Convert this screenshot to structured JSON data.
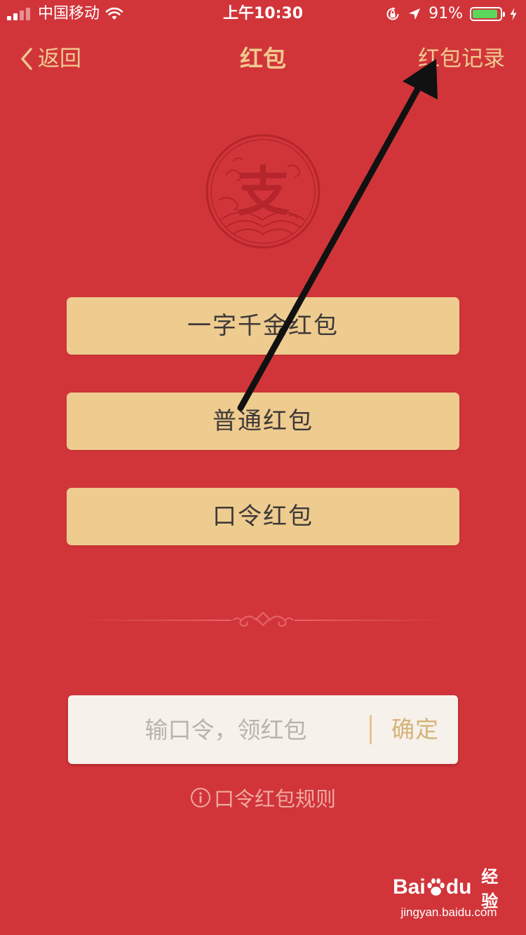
{
  "status_bar": {
    "carrier": "中国移动",
    "time": "上午10:30",
    "battery_percent": "91%",
    "battery_level": 0.91,
    "icons": [
      "signal-icon",
      "wifi-icon",
      "lock-rotation-icon",
      "location-icon",
      "battery-icon",
      "charging-icon"
    ]
  },
  "nav": {
    "back_label": "返回",
    "title": "红包",
    "records_label": "红包记录",
    "back_icon": "chevron-left-icon"
  },
  "logo": {
    "text": "支",
    "icon": "alipay-seal-icon"
  },
  "options": [
    {
      "label": "一字千金红包"
    },
    {
      "label": "普通红包"
    },
    {
      "label": "口令红包"
    }
  ],
  "password": {
    "placeholder": "输口令，领红包",
    "value": "",
    "confirm_label": "确定"
  },
  "rules": {
    "label": "口令红包规则",
    "icon": "info-icon"
  },
  "watermark": {
    "brand_latin_left": "Bai",
    "brand_latin_right": "du",
    "brand_cn": "经验",
    "url": "jingyan.baidu.com"
  },
  "colors": {
    "background": "#d1353a",
    "accent_gold": "#f1c98f",
    "button_fill": "#eecb8f",
    "button_text": "#3e3a39",
    "input_background": "#f6f1ea",
    "confirm_text": "#d6b37a",
    "battery_green": "#5bd75c",
    "annotation_arrow": "#111111"
  }
}
